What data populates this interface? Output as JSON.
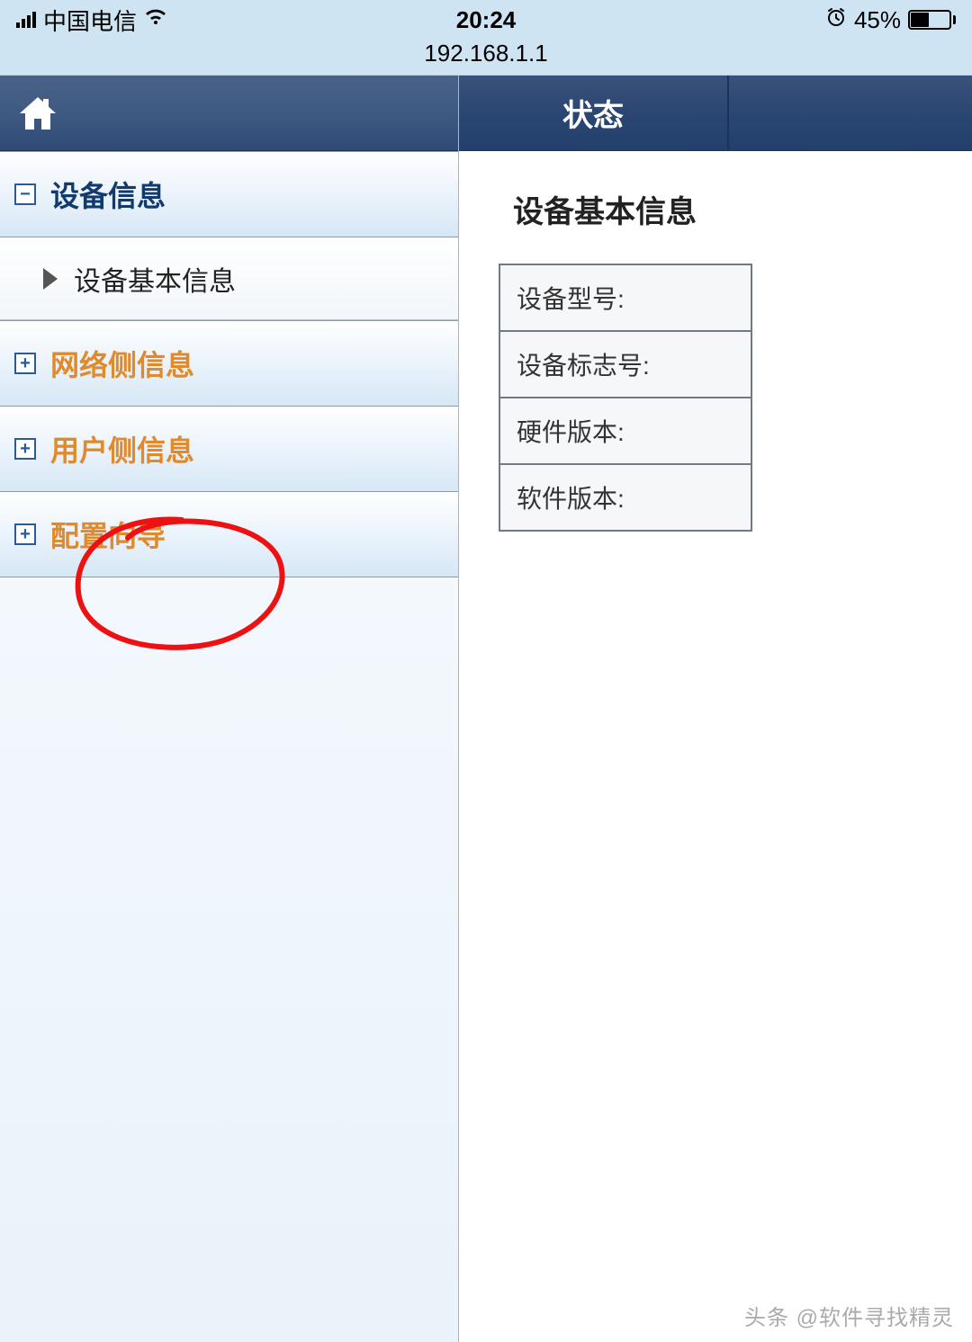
{
  "status_bar": {
    "carrier": "中国电信",
    "time": "20:24",
    "battery_pct": "45%"
  },
  "url": "192.168.1.1",
  "sidebar": {
    "items": [
      {
        "label": "设备信息",
        "expanded": true,
        "toggle": "−"
      },
      {
        "label": "网络侧信息",
        "expanded": false,
        "toggle": "+"
      },
      {
        "label": "用户侧信息",
        "expanded": false,
        "toggle": "+"
      },
      {
        "label": "配置向导",
        "expanded": false,
        "toggle": "+"
      }
    ],
    "sub_item": "设备基本信息"
  },
  "tabs": {
    "active": "状态"
  },
  "panel": {
    "title": "设备基本信息",
    "rows": [
      "设备型号:",
      "设备标志号:",
      "硬件版本:",
      "软件版本:"
    ]
  },
  "watermark": "头条 @软件寻找精灵"
}
